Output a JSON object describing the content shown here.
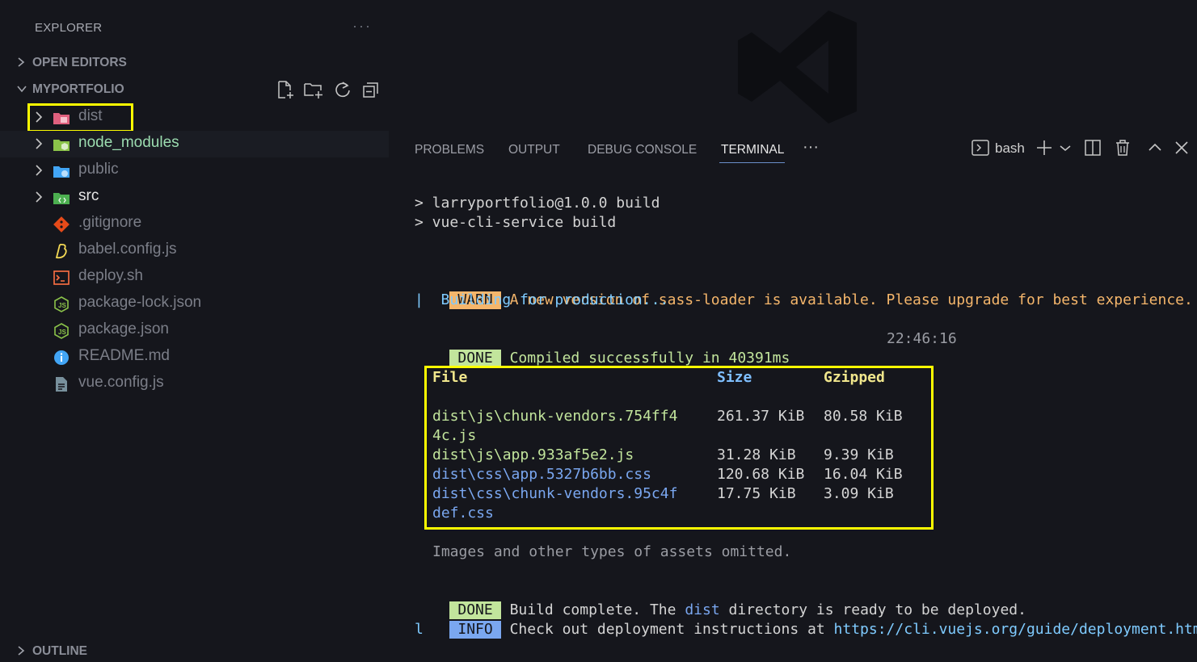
{
  "explorer": {
    "title": "EXPLORER",
    "more": "···",
    "open_editors": "OPEN EDITORS",
    "project": "MYPORTFOLIO",
    "outline": "OUTLINE"
  },
  "tree": [
    {
      "name": "dist",
      "icon": "folder-dist-icon",
      "expandable": true
    },
    {
      "name": "node_modules",
      "icon": "folder-node-icon",
      "expandable": true
    },
    {
      "name": "public",
      "icon": "folder-public-icon",
      "expandable": true
    },
    {
      "name": "src",
      "icon": "folder-src-icon",
      "expandable": true
    },
    {
      "name": ".gitignore",
      "icon": "git-icon",
      "expandable": false
    },
    {
      "name": "babel.config.js",
      "icon": "babel-icon",
      "expandable": false
    },
    {
      "name": "deploy.sh",
      "icon": "shell-icon",
      "expandable": false
    },
    {
      "name": "package-lock.json",
      "icon": "nodejs-icon",
      "expandable": false
    },
    {
      "name": "package.json",
      "icon": "nodejs-icon",
      "expandable": false
    },
    {
      "name": "README.md",
      "icon": "info-icon",
      "expandable": false
    },
    {
      "name": "vue.config.js",
      "icon": "config-file-icon",
      "expandable": false
    }
  ],
  "panel": {
    "tabs": [
      "PROBLEMS",
      "OUTPUT",
      "DEBUG CONSOLE",
      "TERMINAL"
    ],
    "more": "···",
    "shell": "bash"
  },
  "terminal": {
    "cmd1": "> larryportfolio@1.0.0 build",
    "cmd2": "> vue-cli-service build",
    "warn_badge": "WARN",
    "warn_text": "A new version of sass-loader is available. Please upgrade for best experience.",
    "building": "|  Building for production...",
    "done_badge": "DONE",
    "compiled": "Compiled successfully in 40391ms",
    "time": "22:46:16",
    "table_headers": [
      "File",
      "Size",
      "Gzipped"
    ],
    "table_rows": [
      {
        "file": "dist\\js\\chunk-vendors.754ff4",
        "file2": "4c.js",
        "size": "261.37 KiB",
        "gzip": "80.58 KiB",
        "kind": "js"
      },
      {
        "file": "dist\\js\\app.933af5e2.js",
        "size": "31.28 KiB",
        "gzip": "9.39 KiB",
        "kind": "js"
      },
      {
        "file": "dist\\css\\app.5327b6bb.css",
        "size": "120.68 KiB",
        "gzip": "16.04 KiB",
        "kind": "css"
      },
      {
        "file": "dist\\css\\chunk-vendors.95c4f",
        "file2": "def.css",
        "size": "17.75 KiB",
        "gzip": "3.09 KiB",
        "kind": "css"
      }
    ],
    "omitted": "Images and other types of assets omitted.",
    "done2_badge": "DONE",
    "build_pre": "Build complete. The ",
    "build_dist": "dist",
    "build_post": " directory is ready to be deployed.",
    "info_badge": "INFO",
    "info_pre": "Check out deployment instructions at ",
    "info_url": "https://cli.vuejs.org/guide/deployment.htm",
    "info_url_wrap": "l"
  },
  "colors": {
    "background": "#15161c",
    "highlight": "#ffff00",
    "warn": "#f5b66b",
    "done": "#c2e59c",
    "info": "#7aa7f0"
  }
}
